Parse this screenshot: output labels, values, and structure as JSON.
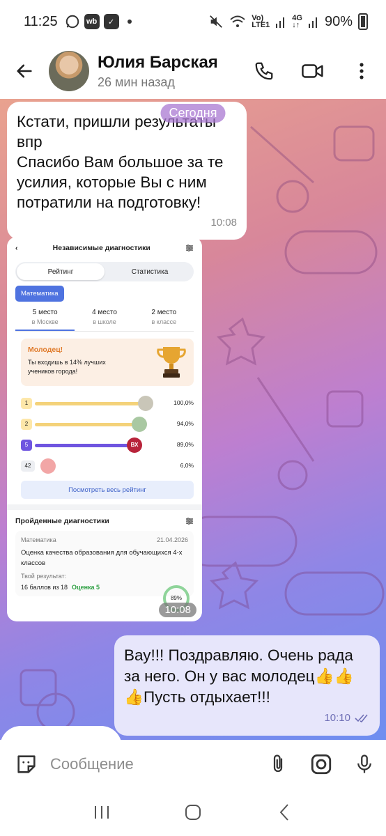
{
  "status_bar": {
    "time": "11:25",
    "app_badge": "wb",
    "network_top": "Vo)",
    "network_bottom": "LTE1",
    "net_type_top": "4G",
    "net_type_bottom": "↓↑",
    "battery": "90%"
  },
  "header": {
    "contact_name": "Юлия Барская",
    "last_seen": "26 мин назад",
    "icons": [
      "back-arrow-icon",
      "phone-icon",
      "video-icon",
      "more-vert-icon"
    ]
  },
  "chat": {
    "date_label": "Сегодня",
    "incoming_message": {
      "lines": [
        "Кстати, пришли результаты",
        "впр",
        "Спасибо Вам большое за те",
        "усилия, которые Вы с ним",
        "потратили на подготовку!"
      ],
      "time": "10:08"
    },
    "screenshot_message": {
      "time": "10:08",
      "title": "Независимые диагностики",
      "tabs": [
        "Рейтинг",
        "Статистика"
      ],
      "subject_chip": "Математика",
      "places": [
        {
          "place": "5 место",
          "where": "в Москве"
        },
        {
          "place": "4 место",
          "where": "в школе"
        },
        {
          "place": "2 место",
          "where": "в классе"
        }
      ],
      "congrats_title": "Молодец!",
      "congrats_text": "Ты входишь в 14% лучших учеников города!",
      "ranking": [
        {
          "rank": "1",
          "pct": "100,0%",
          "fill": 1.0,
          "avatar": ""
        },
        {
          "rank": "2",
          "pct": "94,0%",
          "fill": 0.94,
          "avatar": ""
        },
        {
          "rank": "5",
          "pct": "89,0%",
          "fill": 0.89,
          "avatar": "ВХ"
        },
        {
          "rank": "42",
          "pct": "6,0%",
          "fill": 0.0,
          "avatar": ""
        }
      ],
      "see_all": "Посмотреть весь рейтинг",
      "passed_title": "Пройденные диагностики",
      "card": {
        "subject": "Математика",
        "date": "21.04.2026",
        "title": "Оценка качества образования для обучающихся 4-х классов",
        "result_label": "Твой результат:",
        "score": "16 баллов из 18",
        "grade": "Оценка 5",
        "percent": "89%"
      }
    },
    "outgoing_message": {
      "lines": [
        "Вау!!! Поздравляю. Очень рада",
        "за него. Он у вас молодец👍👍",
        "👍Пусть отдыхает!!!"
      ],
      "time": "10:10"
    }
  },
  "input_bar": {
    "placeholder": "Сообщение"
  }
}
